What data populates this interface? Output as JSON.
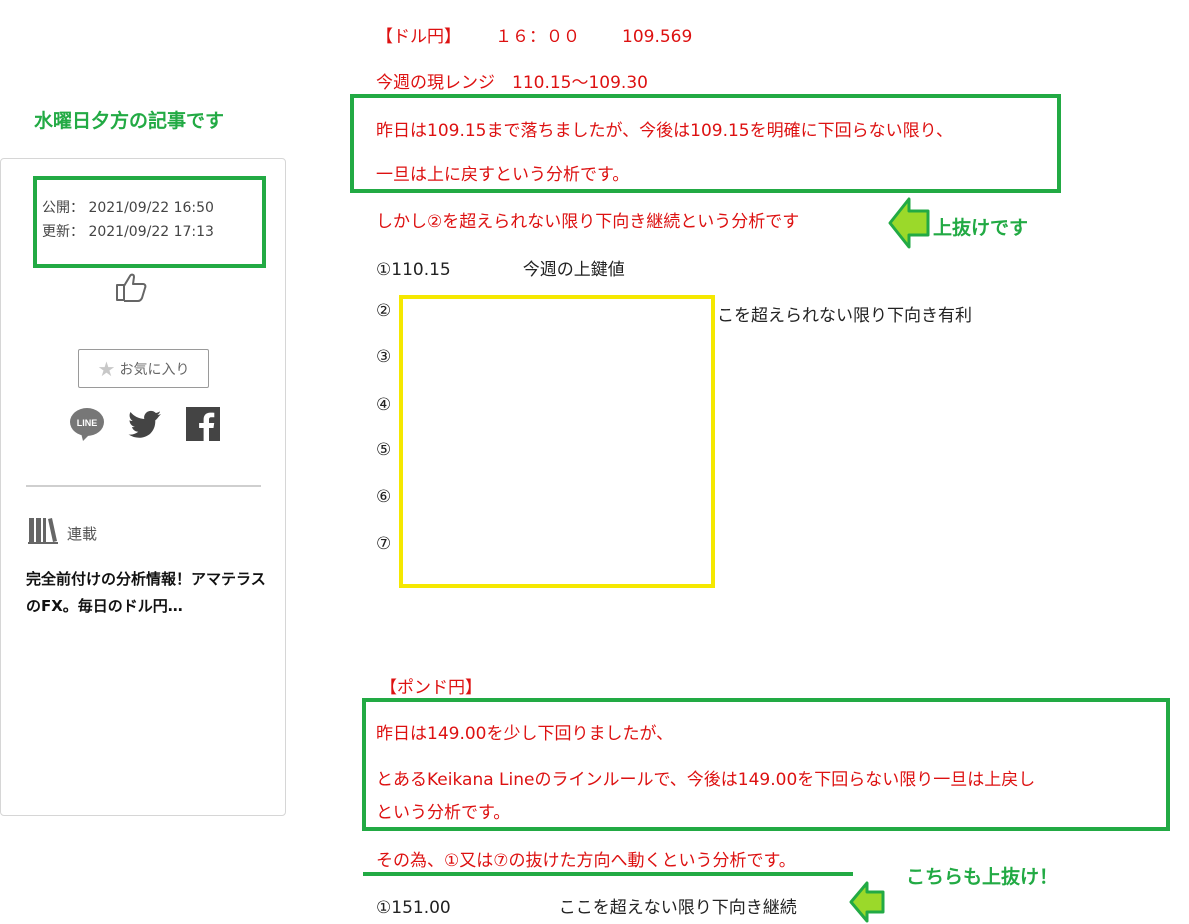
{
  "sidebar": {
    "annotation_heading": "水曜日夕方の記事です",
    "published_label": "公開：",
    "published_value": "2021/09/22 16:50",
    "updated_label": "更新：",
    "updated_value": "2021/09/22 17:13",
    "favorite_label": "お気に入り",
    "share_icons": [
      "line-icon",
      "twitter-icon",
      "facebook-icon"
    ],
    "line_icon_text": "LINE",
    "series_label": "連載",
    "series_title": "完全前付けの分析情報！アマテラスのFX。毎日のドル円…"
  },
  "usdjpy": {
    "header": "【ドル円】",
    "time": "１６：００",
    "price": "109.569",
    "range_line": "今週の現レンジ　110.15～109.30",
    "analysis_line1": "昨日は109.15まで落ちましたが、今後は109.15を明確に下回らない限り、",
    "analysis_line2": "一旦は上に戻すという分析です。",
    "continuation": "しかし②を超えられない限り下向き継続という分析です",
    "annotation": "上抜けです",
    "levels": [
      {
        "mark": "①",
        "value": "110.15",
        "note": "今週の上鍵値"
      },
      {
        "mark": "②",
        "value": "",
        "note": "こを超えられない限り下向き有利"
      },
      {
        "mark": "③",
        "value": "",
        "note": ""
      },
      {
        "mark": "④",
        "value": "",
        "note": ""
      },
      {
        "mark": "⑤",
        "value": "",
        "note": ""
      },
      {
        "mark": "⑥",
        "value": "",
        "note": ""
      },
      {
        "mark": "⑦",
        "value": "",
        "note": ""
      }
    ]
  },
  "gbpjpy": {
    "header": "【ポンド円】",
    "analysis_line1": "昨日は149.00を少し下回りましたが、",
    "analysis_line2": "とあるKeikana Lineのラインルールで、今後は149.00を下回らない限り一旦は上戻し",
    "analysis_line3": "という分析です。",
    "direction_line": "その為、①又は⑦の抜けた方向へ動くという分析です。",
    "annotation": "こちらも上抜け！",
    "level1_mark": "①",
    "level1_value": "151.00",
    "level1_note": "ここを超えない限り下向き継続"
  },
  "colors": {
    "annotation_green": "#22aa44",
    "text_red": "#dd1111",
    "highlight_yellow": "#f5e800",
    "arrow_green": "#9bd92a"
  }
}
